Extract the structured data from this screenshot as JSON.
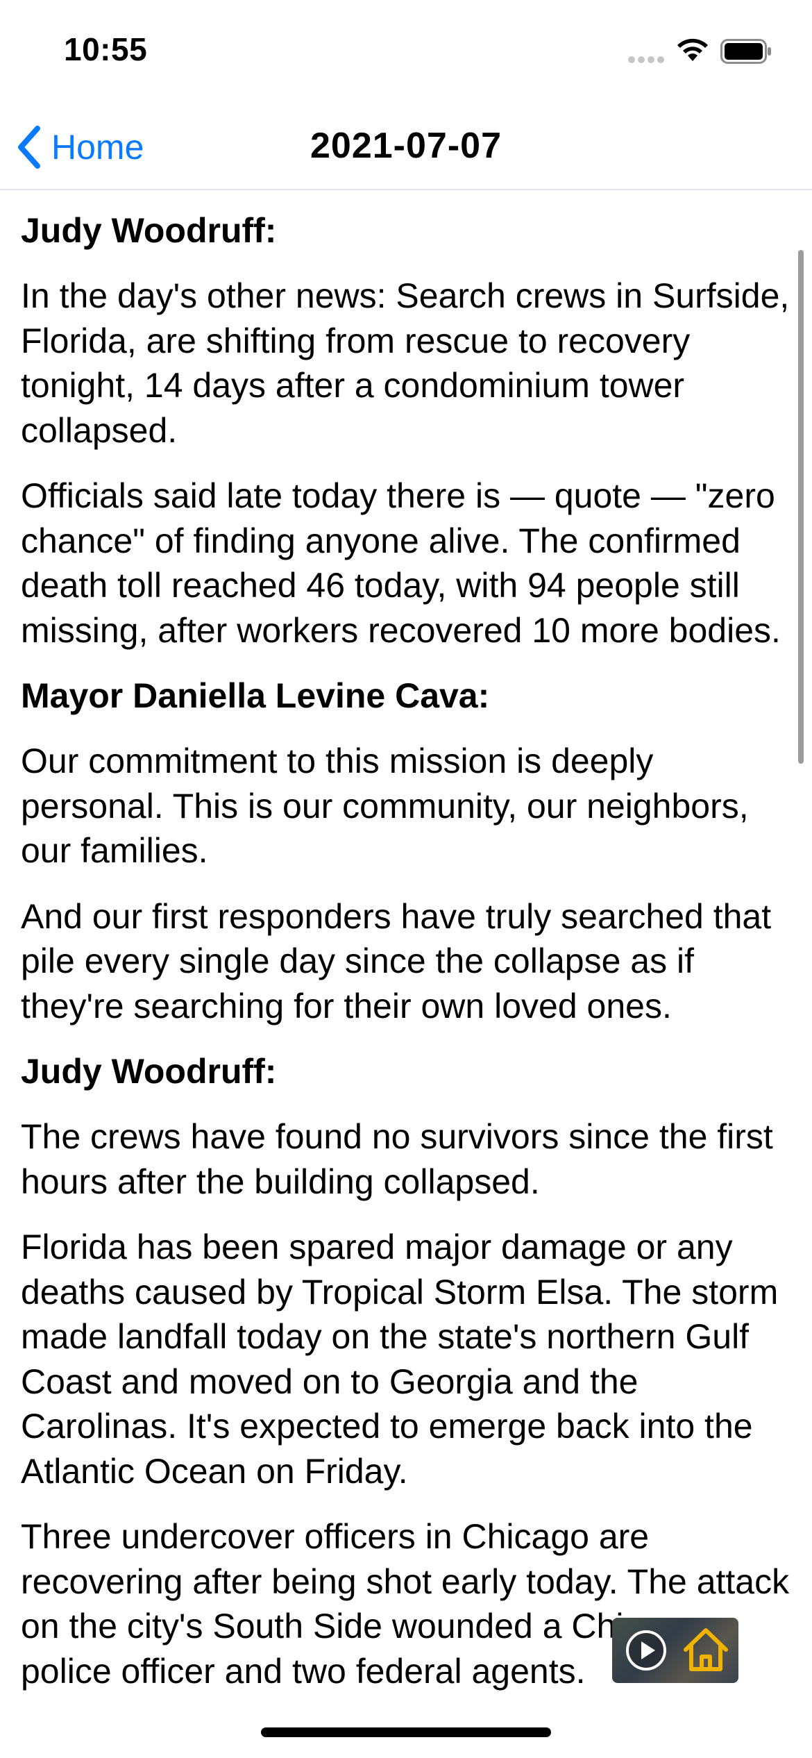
{
  "status_bar": {
    "time": "10:55",
    "icons": [
      "signal-dots-icon",
      "wifi-icon",
      "battery-icon"
    ]
  },
  "nav_bar": {
    "back_label": "Home",
    "title": "2021-07-07",
    "accent_color": "#0a7aff"
  },
  "transcript": [
    {
      "type": "speaker",
      "text": "Judy Woodruff:"
    },
    {
      "type": "paragraph",
      "text": "In the day's other news: Search crews in Surfside, Florida, are shifting from rescue to recovery tonight, 14 days after a condominium tower collapsed."
    },
    {
      "type": "paragraph",
      "text": "Officials said late today there is — quote — \"zero chance\" of finding anyone alive. The confirmed death toll reached 46 today, with 94 people still missing, after workers recovered 10 more bodies."
    },
    {
      "type": "speaker",
      "text": "Mayor Daniella Levine Cava:"
    },
    {
      "type": "paragraph",
      "text": "Our commitment to this mission is deeply personal. This is our community, our neighbors, our families."
    },
    {
      "type": "paragraph",
      "text": "And our first responders have truly searched that pile every single day since the collapse as if they're searching for their own loved ones."
    },
    {
      "type": "speaker",
      "text": "Judy Woodruff:"
    },
    {
      "type": "paragraph",
      "text": "The crews have found no survivors since the first hours after the building collapsed."
    },
    {
      "type": "paragraph",
      "text": "Florida has been spared major damage or any deaths caused by Tropical Storm Elsa. The storm made landfall today on the state's northern Gulf Coast and moved on to Georgia and the Carolinas. It's expected to emerge back into the Atlantic Ocean on Friday."
    },
    {
      "type": "paragraph",
      "text": "Three undercover officers in Chicago are recovering after being shot early today. The attack on the city's South Side wounded a Chicago police officer and two federal agents."
    }
  ],
  "mini_player": {
    "icons": [
      "play-icon",
      "home-icon"
    ],
    "home_icon_color": "#f0b400"
  }
}
